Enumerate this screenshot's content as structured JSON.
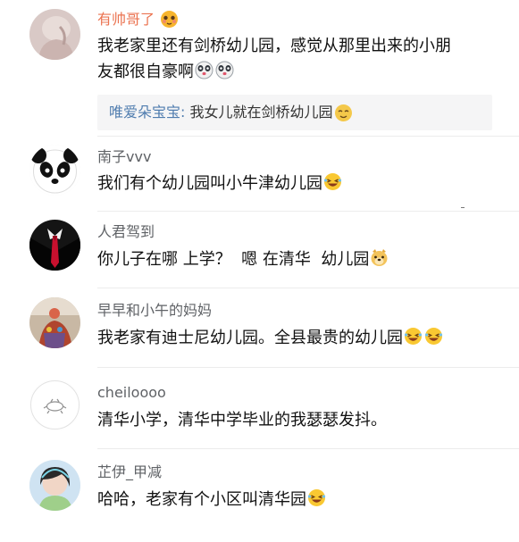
{
  "comments": [
    {
      "username": "有帅哥了",
      "content_line1": "我老家里还有剑桥幼儿园，感觉从那里出来的小朋",
      "content_line2": "友都很自豪啊",
      "reply": {
        "name": "唯爱朵宝宝:",
        "text": " 我女儿就在剑桥幼儿园"
      }
    },
    {
      "username": "南子vvv",
      "content": "我们有个幼儿园叫小牛津幼儿园"
    },
    {
      "username": "人君驾到",
      "content": "你儿子在哪 上学？  嗯 在清华  幼儿园"
    },
    {
      "username": "早早和小午的妈妈",
      "content": "我老家有迪士尼幼儿园。全县最贵的幼儿园"
    },
    {
      "username": "cheiloooo",
      "content": "清华小学，清华中学毕业的我瑟瑟发抖。"
    },
    {
      "username": "芷伊_甲减",
      "content": "哈哈，老家有个小区叫清华园"
    }
  ],
  "colors": {
    "vip_name": "#eb7350",
    "username": "#5f6266",
    "reply_name": "#507daf",
    "text": "#111111"
  },
  "icons": [
    "shy-emoji-icon",
    "panda-emoji-icon",
    "laughing-emoji-icon",
    "doge-emoji-icon",
    "wink-emoji-icon"
  ]
}
